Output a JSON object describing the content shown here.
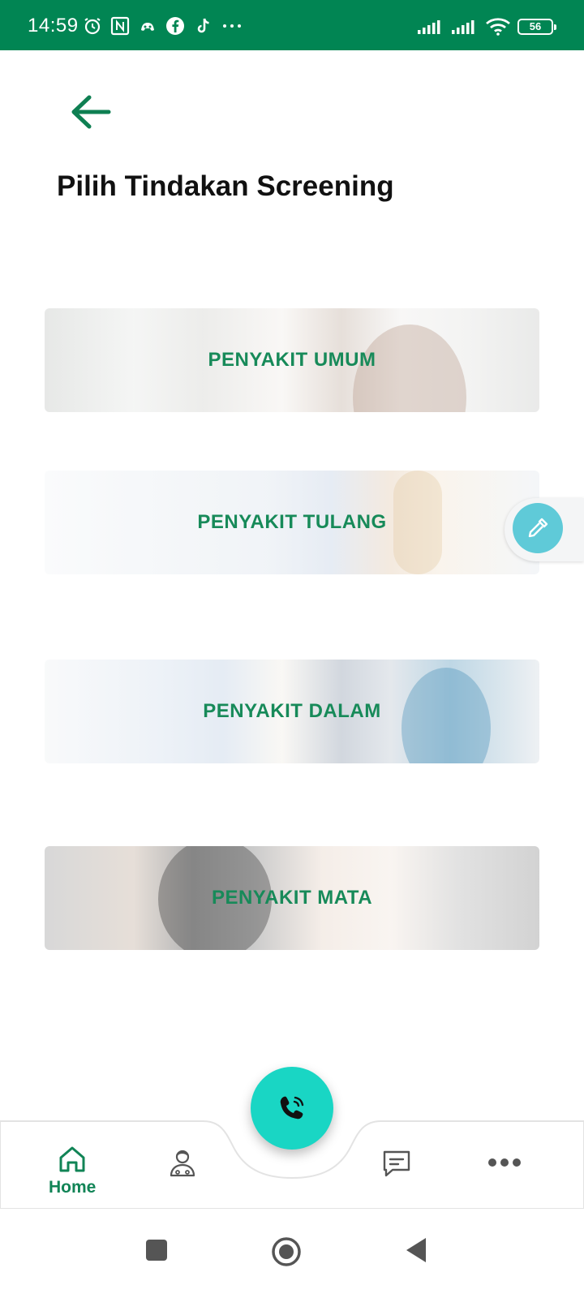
{
  "status_bar": {
    "time": "14:59",
    "battery": "56",
    "icons": [
      "alarm-icon",
      "nfc-icon",
      "discord-icon",
      "facebook-icon",
      "tiktok-icon",
      "more-dots-icon",
      "signal-icon",
      "signal-icon",
      "wifi-icon",
      "battery-icon"
    ],
    "background_color": "#018553"
  },
  "header": {
    "back_icon": "arrow-left-icon",
    "title": "Pilih Tindakan Screening"
  },
  "categories": [
    {
      "label": "PENYAKIT UMUM"
    },
    {
      "label": "PENYAKIT TULANG"
    },
    {
      "label": "PENYAKIT DALAM"
    },
    {
      "label": "PENYAKIT MATA"
    }
  ],
  "side_button": {
    "icon": "eyedropper-icon",
    "color": "#5fcad8"
  },
  "bottom_nav": {
    "items": [
      {
        "label": "Home",
        "icon": "home-icon",
        "active": true
      },
      {
        "label": "",
        "icon": "doctor-icon"
      },
      {
        "label": "",
        "icon": "chat-icon"
      },
      {
        "label": "",
        "icon": "more-icon"
      }
    ],
    "center_button": {
      "icon": "phone-call-icon",
      "color": "#19d6c4"
    },
    "accent_color": "#118456"
  },
  "system_nav": {
    "buttons": [
      "recent-apps-icon",
      "home-circle-icon",
      "back-triangle-icon"
    ]
  }
}
